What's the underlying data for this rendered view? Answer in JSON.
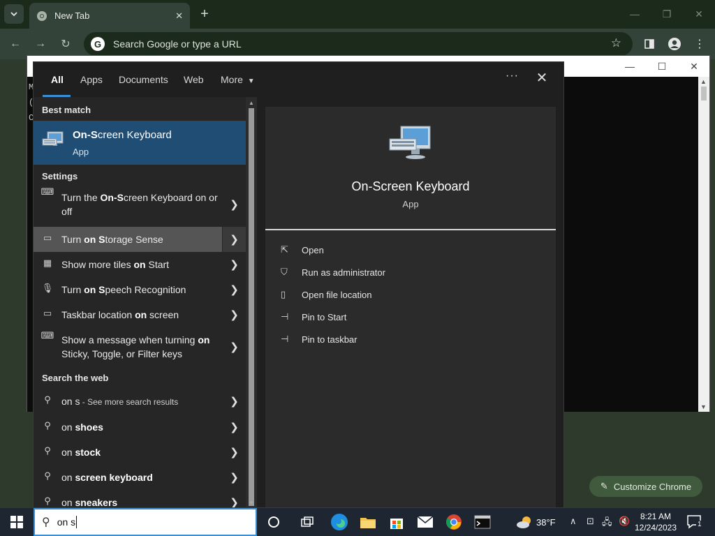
{
  "chrome": {
    "tab_title": "New Tab",
    "new_tab": "+",
    "omnibox_placeholder": "Search Google or type a URL",
    "customize_label": "Customize Chrome"
  },
  "console": {
    "lines": [
      "M",
      "(",
      "C"
    ]
  },
  "search": {
    "scope_tabs": [
      "All",
      "Apps",
      "Documents",
      "Web",
      "More"
    ],
    "active_scope": "All",
    "more_options": "···",
    "close": "✕",
    "best_match": {
      "heading": "Best match",
      "name_bold": "On-S",
      "name_rest": "creen Keyboard",
      "kind": "App"
    },
    "settings": {
      "heading": "Settings",
      "items": [
        {
          "pre": "Turn the ",
          "bold": "On-S",
          "post": "creen Keyboard on or off",
          "icon": "keyboard-icon"
        },
        {
          "pre": "Turn ",
          "bold": "on S",
          "post": "torage Sense",
          "icon": "storage-icon"
        },
        {
          "pre": "Show more tiles ",
          "bold": "on",
          "post": " Start",
          "icon": "tiles-icon"
        },
        {
          "pre": "Turn ",
          "bold": "on S",
          "post": "peech Recognition",
          "icon": "microphone-icon"
        },
        {
          "pre": "Taskbar location ",
          "bold": "on",
          "post": " screen",
          "icon": "taskbar-icon"
        },
        {
          "pre": "Show a message when turning ",
          "bold": "on",
          "post": " Sticky, Toggle, or Filter keys",
          "icon": "keyboard-icon"
        }
      ]
    },
    "web": {
      "heading": "Search the web",
      "items": [
        {
          "pre": "on s",
          "suffix": " - See more search results"
        },
        {
          "pre": "on ",
          "bold": "shoes"
        },
        {
          "pre": "on ",
          "bold": "stock"
        },
        {
          "pre": "on ",
          "bold": "screen keyboard"
        },
        {
          "pre": "on ",
          "bold": "sneakers"
        }
      ]
    },
    "preview": {
      "title": "On-Screen Keyboard",
      "kind": "App",
      "actions": [
        "Open",
        "Run as administrator",
        "Open file location",
        "Pin to Start",
        "Pin to taskbar"
      ]
    },
    "query": "on s"
  },
  "taskbar": {
    "weather": "38°F",
    "time": "8:21 AM",
    "date": "12/24/2023",
    "notifications": "1"
  }
}
